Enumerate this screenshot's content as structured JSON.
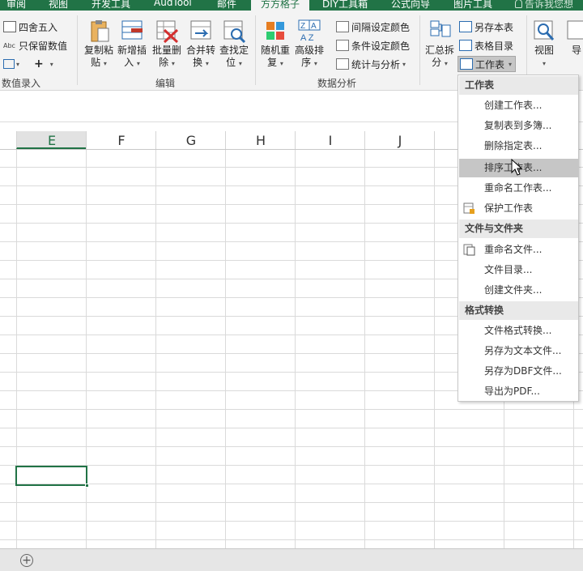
{
  "tabs": [
    "审阅",
    "视图",
    "开发工具",
    "AudTool",
    "邮件",
    "方方格子",
    "DIY工具箱",
    "公式向导",
    "图片工具"
  ],
  "active_tab": "方方格子",
  "tell_me": "告诉我您想",
  "ribbon": {
    "numeric_group": {
      "round": "四舍五入",
      "keep_value": "只保留数值",
      "abc": "Abc",
      "label": "数值录入"
    },
    "edit_group": {
      "label": "编辑",
      "buttons": [
        {
          "l1": "复制粘",
          "l2": "贴"
        },
        {
          "l1": "新增插",
          "l2": "入"
        },
        {
          "l1": "批量删",
          "l2": "除"
        },
        {
          "l1": "合并转",
          "l2": "换"
        },
        {
          "l1": "查找定",
          "l2": "位"
        }
      ]
    },
    "analysis_group": {
      "label": "数据分析",
      "random": {
        "l1": "随机重",
        "l2": "复"
      },
      "sort": {
        "l1": "高级排",
        "l2": "序"
      },
      "interval_color": "间隔设定颜色",
      "cond_color": "条件设定颜色",
      "stats": "统计与分析"
    },
    "summary": {
      "l1": "汇总拆",
      "l2": "分"
    },
    "save_sheet": "另存本表",
    "table_dir": "表格目录",
    "worksheet": "工作表",
    "view": "视图",
    "nav_partial": "导"
  },
  "columns": [
    "E",
    "F",
    "G",
    "H",
    "I",
    "J"
  ],
  "selected_column": "E",
  "dropdown": {
    "sections": [
      {
        "header": "工作表",
        "items": [
          {
            "label": "创建工作表...",
            "icon": ""
          },
          {
            "label": "复制表到多簿...",
            "icon": ""
          },
          {
            "label": "删除指定表...",
            "icon": ""
          },
          {
            "label": "排序工作表...",
            "icon": "",
            "hover": true
          },
          {
            "label": "重命名工作表...",
            "icon": ""
          },
          {
            "label": "保护工作表",
            "icon": "lock-sheet-icon"
          }
        ]
      },
      {
        "header": "文件与文件夹",
        "items": [
          {
            "label": "重命名文件...",
            "icon": "rename-file-icon"
          },
          {
            "label": "文件目录...",
            "icon": ""
          },
          {
            "label": "创建文件夹...",
            "icon": ""
          }
        ]
      },
      {
        "header": "格式转换",
        "items": [
          {
            "label": "文件格式转换...",
            "icon": ""
          },
          {
            "label": "另存为文本文件...",
            "icon": ""
          },
          {
            "label": "另存为DBF文件...",
            "icon": ""
          },
          {
            "label": "导出为PDF...",
            "icon": ""
          }
        ]
      }
    ]
  },
  "status": {
    "add_sheet_symbol": "⊕"
  },
  "colors": {
    "accent": "#217346",
    "menu_hover": "#c6c6c6",
    "menu_header": "#e9e9e9"
  }
}
